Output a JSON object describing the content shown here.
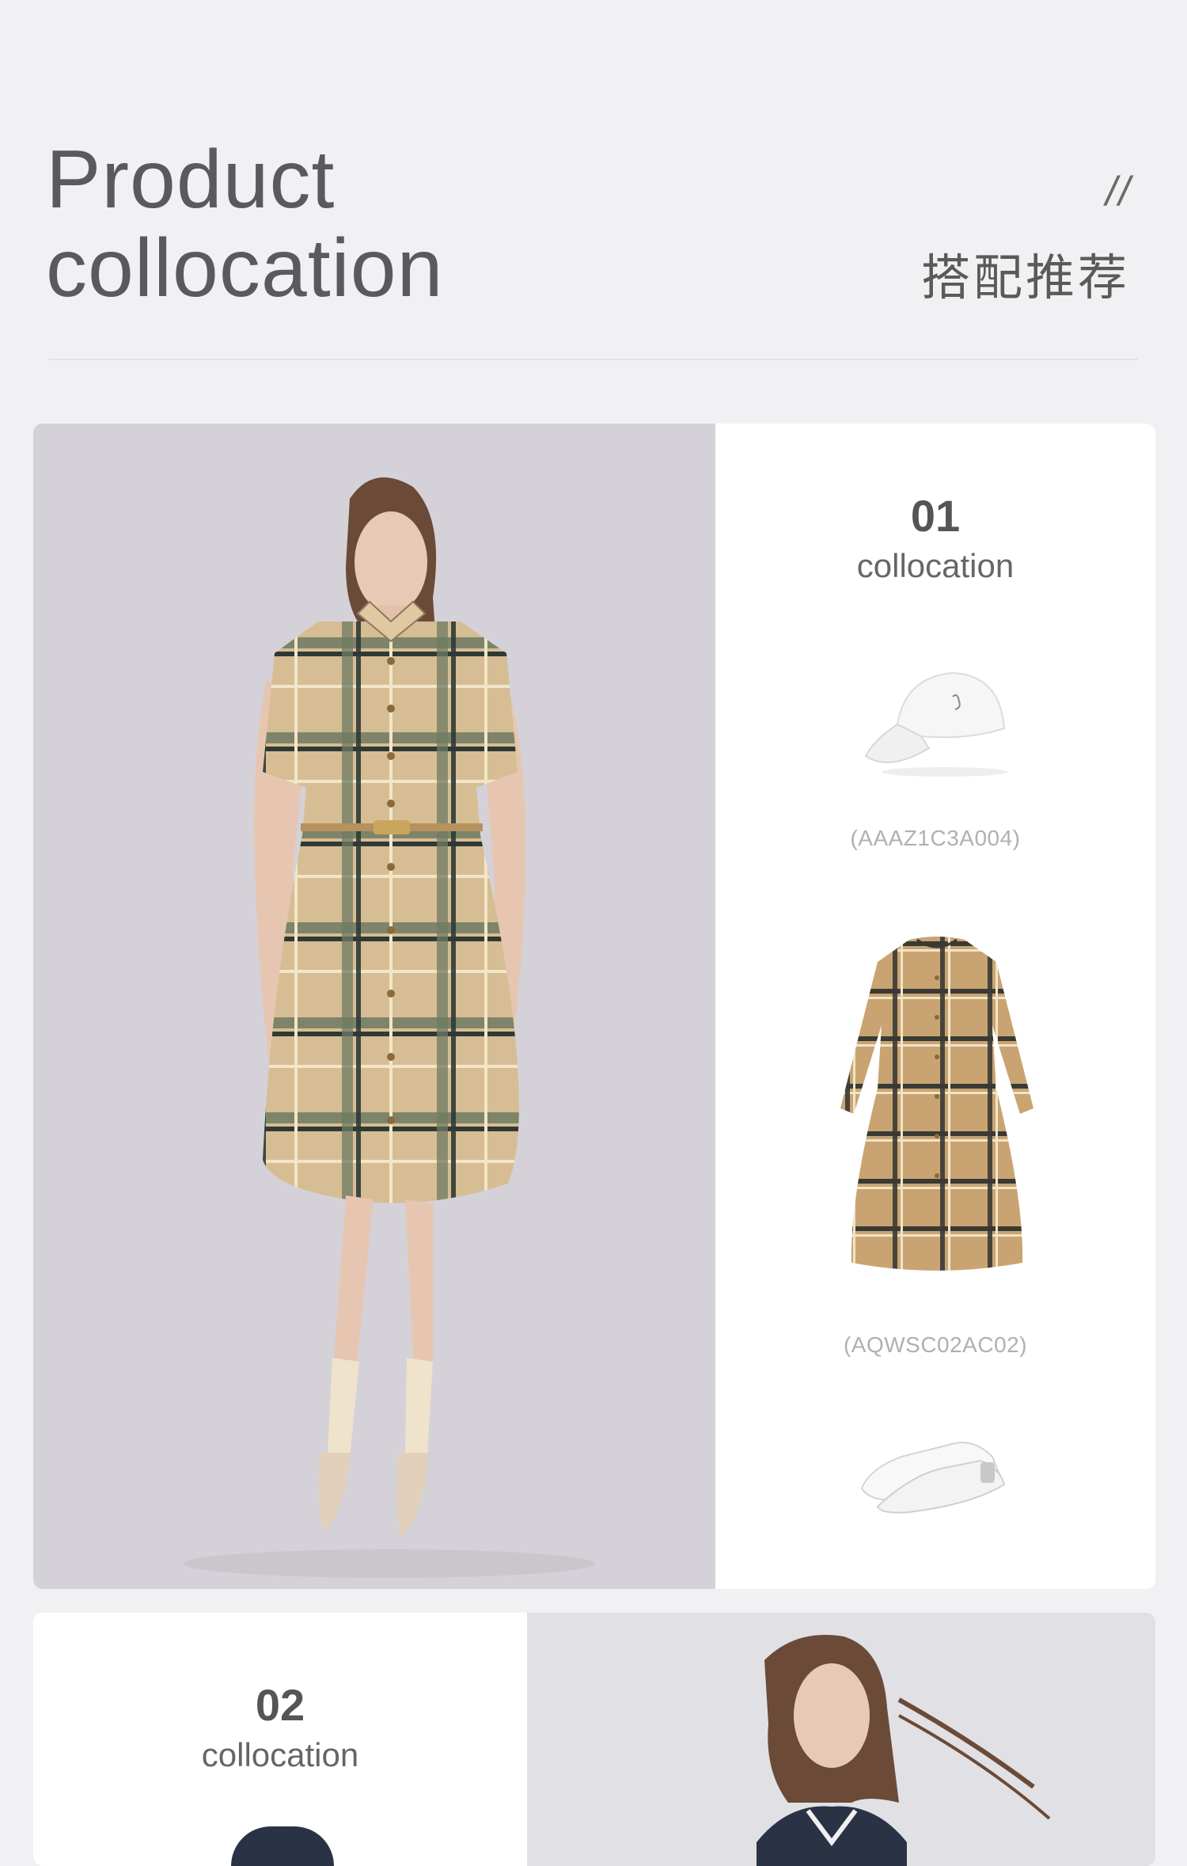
{
  "header": {
    "title_line1": "Product",
    "title_line2": "collocation",
    "slashes": "//",
    "cn_title": "搭配推荐"
  },
  "collocations": [
    {
      "number": "01",
      "label": "collocation",
      "items": [
        {
          "name": "cap",
          "code": "(AAAZ1C3A004)"
        },
        {
          "name": "plaid-dress",
          "code": "(AQWSC02AC02)"
        },
        {
          "name": "sneakers",
          "code": ""
        }
      ]
    },
    {
      "number": "02",
      "label": "collocation"
    }
  ],
  "colors": {
    "background": "#f1f1f3",
    "card": "#ffffff",
    "plaid_base": "#d7bd93",
    "plaid_dark": "#2f3a37",
    "plaid_green": "#6f7a62",
    "plaid_cream": "#f1e6c8"
  }
}
